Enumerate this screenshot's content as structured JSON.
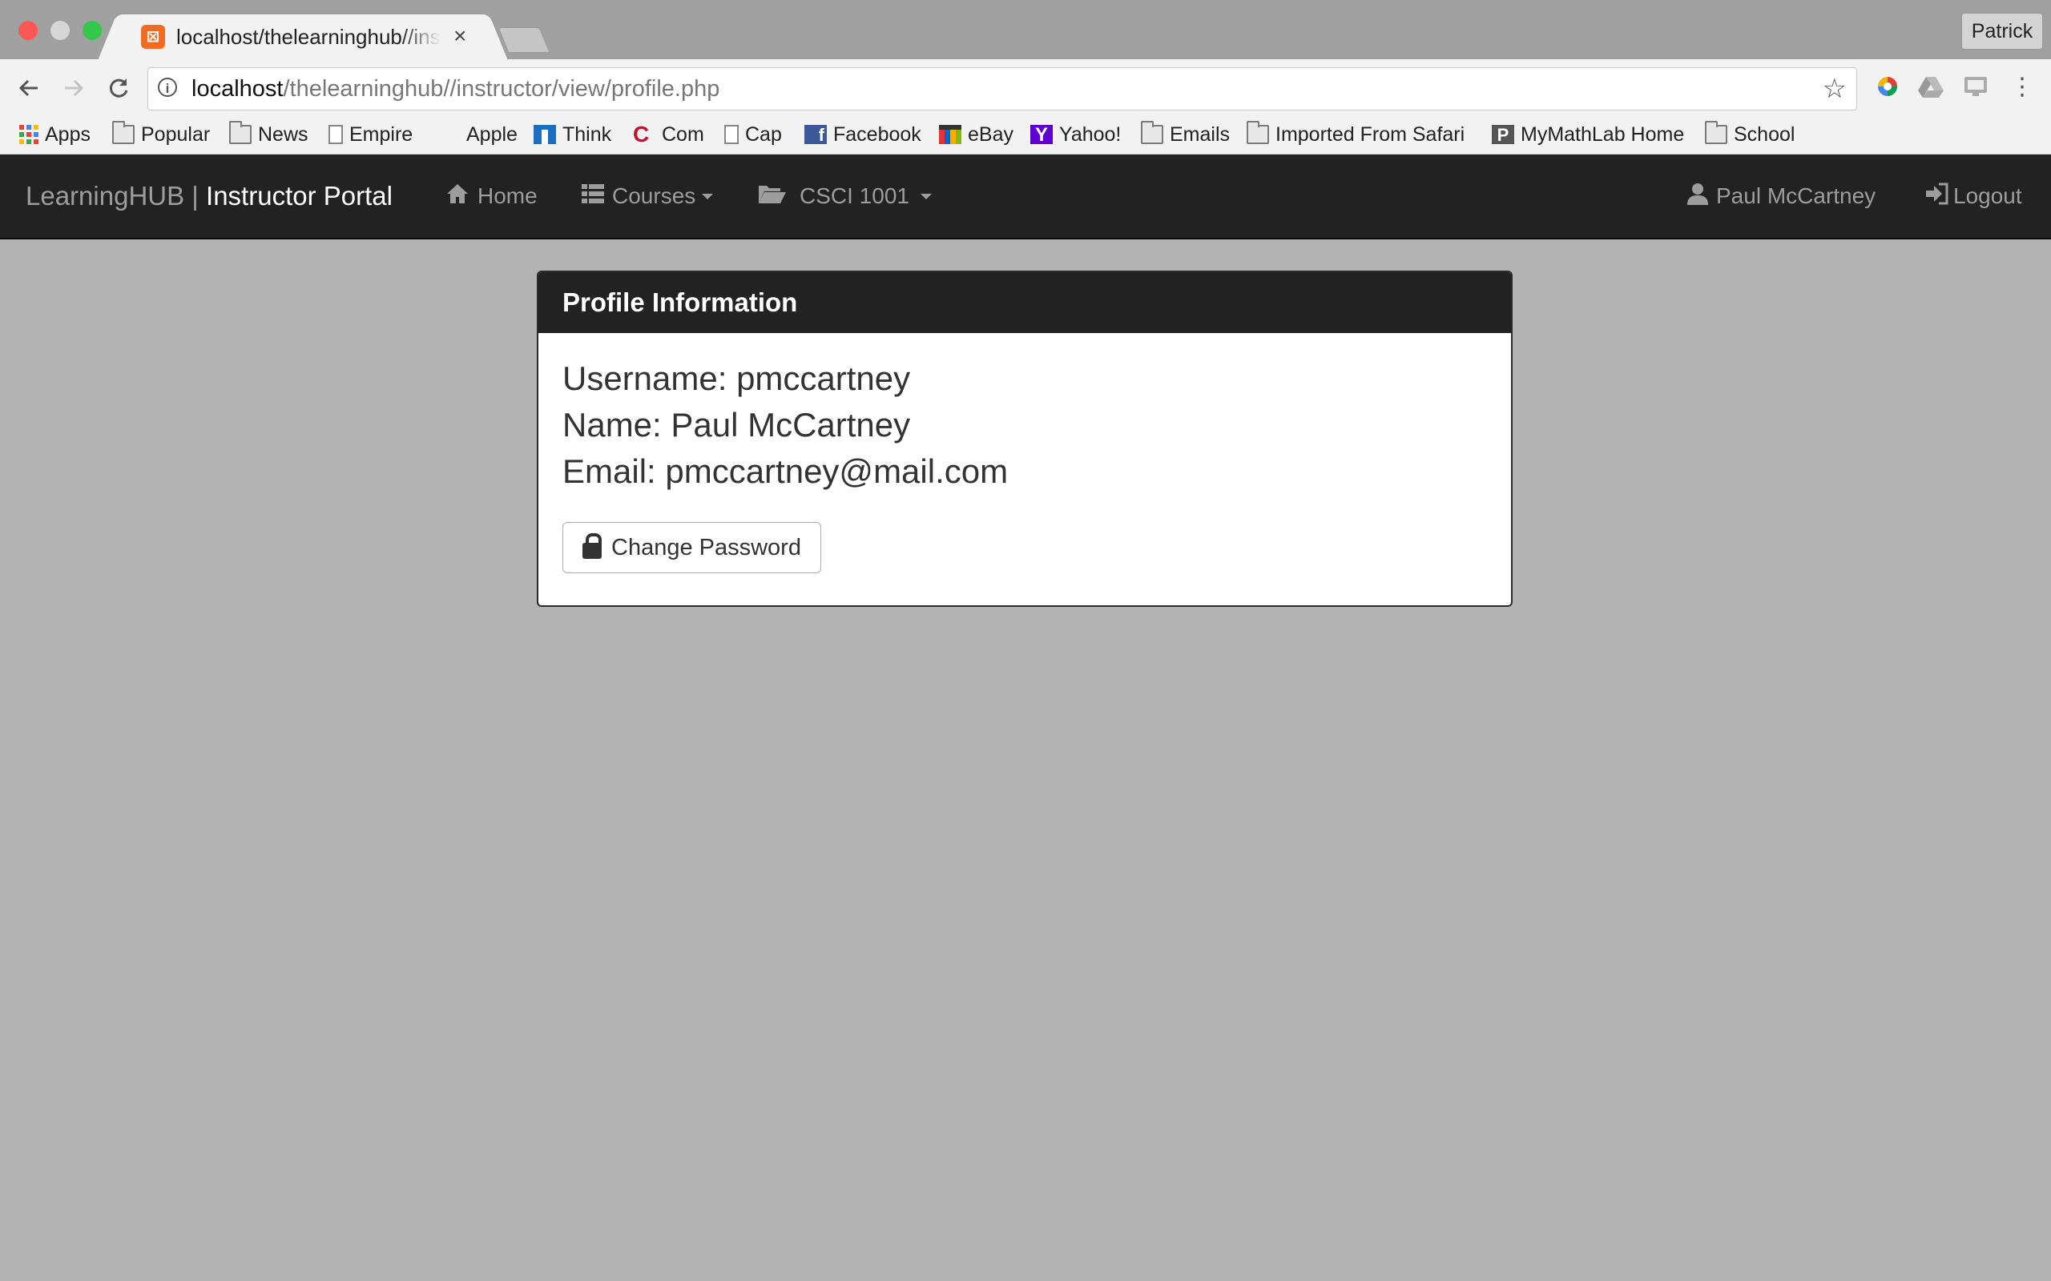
{
  "window": {
    "tab_title": "localhost/thelearninghub//instructor/view/profile.php",
    "tab_close": "×",
    "profile_name": "Patrick"
  },
  "toolbar": {
    "url_host": "localhost",
    "url_path": "/thelearninghub//instructor/view/profile.php",
    "star": "☆",
    "menu": "⋮"
  },
  "bookmarks": [
    {
      "label": "Apps",
      "icon": "apps-grid-icon"
    },
    {
      "label": "Popular",
      "icon": "folder-icon"
    },
    {
      "label": "News",
      "icon": "folder-icon"
    },
    {
      "label": "Empire",
      "icon": "page-icon"
    },
    {
      "label": "Apple",
      "icon": "apple-icon"
    },
    {
      "label": "Think",
      "icon": "think-icon"
    },
    {
      "label": "Com",
      "icon": "com-icon"
    },
    {
      "label": "Cap",
      "icon": "page-icon"
    },
    {
      "label": "Facebook",
      "icon": "facebook-icon"
    },
    {
      "label": "eBay",
      "icon": "ebay-icon"
    },
    {
      "label": "Yahoo!",
      "icon": "yahoo-icon"
    },
    {
      "label": "Emails",
      "icon": "folder-icon"
    },
    {
      "label": "Imported From Safari",
      "icon": "folder-icon"
    },
    {
      "label": "MyMathLab Home",
      "icon": "mymathlab-icon"
    },
    {
      "label": "School",
      "icon": "folder-icon"
    }
  ],
  "navbar": {
    "brand_main": "LearningHUB |",
    "brand_sub": "Instructor Portal",
    "home": "Home",
    "courses": "Courses",
    "course": "CSCI 1001",
    "user": "Paul McCartney",
    "logout": "Logout"
  },
  "panel": {
    "title": "Profile Information",
    "username": "Username: pmccartney",
    "name": "Name: Paul McCartney",
    "email": "Email: pmccartney@mail.com",
    "change_password": "Change Password"
  },
  "colors": {
    "navbar_bg": "#222222",
    "page_bg": "#b3b3b3",
    "nav_text": "#9d9d9d"
  }
}
